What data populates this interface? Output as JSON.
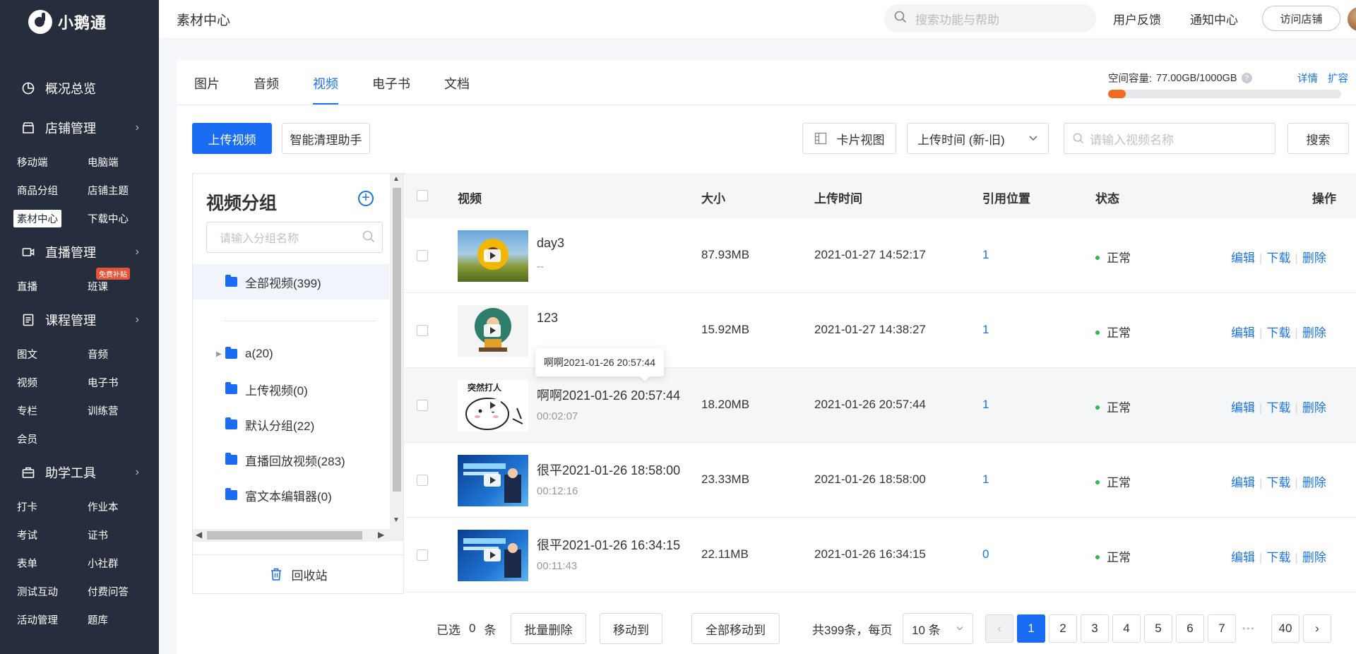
{
  "brand": {
    "name": "小鹅通"
  },
  "sidebar": {
    "sections": [
      {
        "label": "概况总览",
        "icon": "pie-chart-icon",
        "items": []
      },
      {
        "label": "店铺管理",
        "icon": "store-icon",
        "items": [
          "移动端",
          "电脑端",
          "商品分组",
          "店铺主题",
          "素材中心",
          "下载中心"
        ]
      },
      {
        "label": "直播管理",
        "icon": "video-camera-icon",
        "items": [
          "直播",
          "班课"
        ]
      },
      {
        "label": "课程管理",
        "icon": "document-icon",
        "items": [
          "图文",
          "音频",
          "视频",
          "电子书",
          "专栏",
          "训练营",
          "会员"
        ]
      },
      {
        "label": "助学工具",
        "icon": "toolbox-icon",
        "items": [
          "打卡",
          "作业本",
          "考试",
          "证书",
          "表单",
          "小社群",
          "测试互动",
          "付费问答",
          "活动管理",
          "题库"
        ]
      }
    ],
    "active_item": "素材中心",
    "badge": "免费补贴"
  },
  "topbar": {
    "breadcrumb": "素材中心",
    "search_placeholder": "搜索功能与帮助",
    "feedback": "用户反馈",
    "notifications": "通知中心",
    "visit_store": "访问店铺"
  },
  "tabs": [
    "图片",
    "音频",
    "视频",
    "电子书",
    "文档"
  ],
  "active_tab": "视频",
  "capacity": {
    "label": "空间容量:",
    "value": "77.00GB/1000GB",
    "used_fraction": 0.077,
    "details": "详情",
    "expand": "扩容"
  },
  "toolbar": {
    "upload": "上传视频",
    "cleanup": "智能清理助手",
    "card_view": "卡片视图",
    "sort": "上传时间 (新-旧)",
    "search_placeholder": "请输入视频名称",
    "search_btn": "搜索"
  },
  "groups": {
    "title": "视频分组",
    "search_placeholder": "请输入分组名称",
    "items": [
      "全部视频(399)",
      "a(20)",
      "上传视频(0)",
      "默认分组(22)",
      "直播回放视频(283)",
      "富文本编辑器(0)"
    ],
    "recycle": "回收站"
  },
  "table": {
    "columns": [
      "视频",
      "大小",
      "上传时间",
      "引用位置",
      "状态",
      "操作"
    ],
    "rows": [
      {
        "name": "day3",
        "duration": "--",
        "size": "87.93MB",
        "time": "2021-01-27 14:52:17",
        "ref": "1",
        "status": "正常"
      },
      {
        "name": "123",
        "duration": "",
        "size": "15.92MB",
        "time": "2021-01-27 14:38:27",
        "ref": "1",
        "status": "正常"
      },
      {
        "name": "啊啊2021-01-26 20:57:44",
        "duration": "00:02:07",
        "size": "18.20MB",
        "time": "2021-01-26 20:57:44",
        "ref": "1",
        "status": "正常"
      },
      {
        "name": "很平2021-01-26 18:58:00",
        "duration": "00:12:16",
        "size": "23.33MB",
        "time": "2021-01-26 18:58:00",
        "ref": "1",
        "status": "正常"
      },
      {
        "name": "很平2021-01-26 16:34:15",
        "duration": "00:11:43",
        "size": "22.11MB",
        "time": "2021-01-26 16:34:15",
        "ref": "0",
        "status": "正常"
      }
    ],
    "ops": [
      "编辑",
      "下载",
      "删除"
    ],
    "tooltip": "啊啊2021-01-26 20:57:44"
  },
  "footer": {
    "selected_prefix": "已选",
    "selected_count": "0",
    "selected_suffix": "条",
    "batch_delete": "批量删除",
    "move_to": "移动到",
    "move_all": "全部移动到",
    "total": "共399条，每页",
    "page_size": "10 条",
    "pages": [
      "1",
      "2",
      "3",
      "4",
      "5",
      "6",
      "7"
    ],
    "ellipsis": "•••",
    "last_page": "40",
    "current_page": "1"
  },
  "colors": {
    "primary": "#1a6cf2",
    "sidebar_bg": "#262d3d",
    "status_ok": "#2fb94b",
    "capacity_fill": "#f06a1f"
  }
}
